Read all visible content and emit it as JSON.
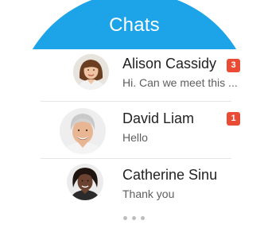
{
  "header": {
    "title": "Chats"
  },
  "chats": [
    {
      "name": "Alison Cassidy",
      "preview": "Hi. Can we meet this ...",
      "unread": "3"
    },
    {
      "name": "David Liam",
      "preview": "Hello",
      "unread": "1"
    },
    {
      "name": "Catherine Sinu",
      "preview": "Thank you",
      "unread": ""
    }
  ],
  "colors": {
    "header_background": "#1ca3e8",
    "header_text": "#ffffff",
    "badge_background": "#e94b35",
    "name_text": "#222222",
    "preview_text": "#5e5e5e",
    "more_dots": "#bdbdbd"
  },
  "icons": {
    "more": "three-dots-icon"
  }
}
